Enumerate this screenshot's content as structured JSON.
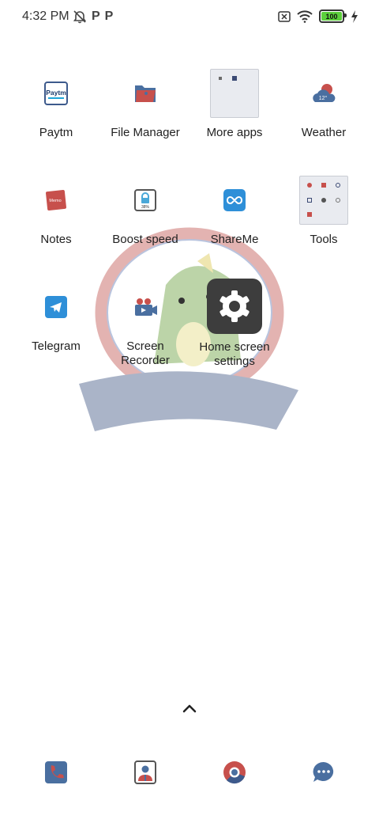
{
  "status_bar": {
    "time": "4:32 PM",
    "left_icons": [
      "alarm-off-icon",
      "p-icon",
      "p-icon"
    ],
    "battery_level": "100",
    "battery_fraction": 1.0,
    "right_icons": [
      "no-sim-icon",
      "wifi-icon",
      "battery-icon",
      "charging-icon"
    ]
  },
  "apps": [
    {
      "label": "Paytm",
      "icon": "paytm-icon"
    },
    {
      "label": "File Manager",
      "icon": "folder-icon"
    },
    {
      "label": "More apps",
      "icon": "folder-more-apps-icon"
    },
    {
      "label": "Weather",
      "icon": "weather-icon",
      "badge": "12°"
    },
    {
      "label": "Notes",
      "icon": "notes-icon"
    },
    {
      "label": "Boost speed",
      "icon": "boost-speed-icon",
      "badge": "38%"
    },
    {
      "label": "ShareMe",
      "icon": "shareme-icon"
    },
    {
      "label": "Tools",
      "icon": "folder-tools-icon"
    },
    {
      "label": "Telegram",
      "icon": "telegram-icon"
    },
    {
      "label": "Screen\nRecorder",
      "icon": "screen-recorder-icon"
    },
    {
      "label": "Home screen settings",
      "icon": "settings-gear-icon"
    }
  ],
  "icon_text": {
    "paytm": "Paytm",
    "memo": "Memo"
  },
  "dock": [
    {
      "name": "phone",
      "icon": "phone-icon"
    },
    {
      "name": "contacts",
      "icon": "contacts-icon"
    },
    {
      "name": "browser",
      "icon": "chrome-icon"
    },
    {
      "name": "messages",
      "icon": "messages-icon"
    }
  ],
  "colors": {
    "icon_blue": "#4a6fa0",
    "icon_red": "#c0392b",
    "settings_bg": "#3d3d3d",
    "battery_green": "#5ccf3c"
  }
}
